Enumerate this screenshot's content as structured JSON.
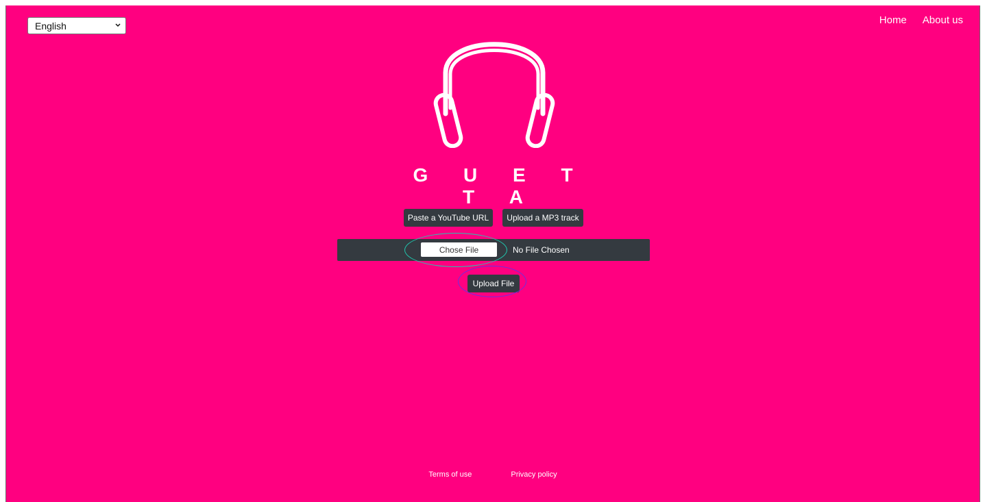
{
  "language_select": {
    "selected": "English"
  },
  "nav": {
    "home": "Home",
    "about": "About us"
  },
  "brand": {
    "name": "G U E T T A",
    "icon": "headphones-icon"
  },
  "tabs": {
    "youtube": "Paste a YouTube URL",
    "mp3": "Upload a MP3 track"
  },
  "file_input": {
    "choose_label": "Chose File",
    "status": "No File Chosen"
  },
  "upload": {
    "label": "Upload File"
  },
  "footer": {
    "terms": "Terms of use",
    "privacy": "Privacy policy"
  },
  "colors": {
    "background": "#ff0080",
    "button_dark": "#343a40",
    "annotation_teal": "#20c9b0",
    "annotation_purple": "#6b2ee0"
  }
}
